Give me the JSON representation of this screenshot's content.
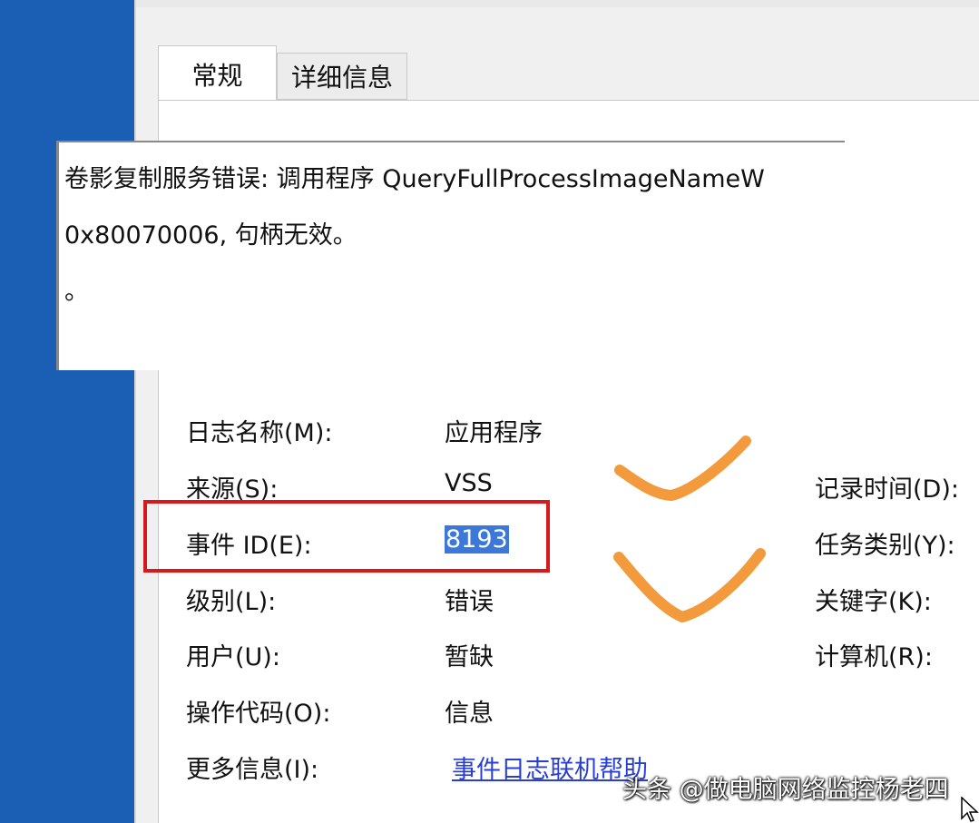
{
  "tabs": [
    {
      "label": "常规",
      "active": true
    },
    {
      "label": "详细信息",
      "active": false
    }
  ],
  "description": {
    "lines": [
      "卷影复制服务错误: 调用程序 QueryFullProcessImageNameW",
      "0x80070006, 句柄无效。",
      "。"
    ]
  },
  "fields_left": [
    {
      "label": "日志名称(M):",
      "value": "应用程序"
    },
    {
      "label": "来源(S):",
      "value": "VSS"
    },
    {
      "label": "事件 ID(E):",
      "value": "8193"
    },
    {
      "label": "级别(L):",
      "value": "错误"
    },
    {
      "label": "用户(U):",
      "value": "暂缺"
    },
    {
      "label": "操作代码(O):",
      "value": "信息"
    },
    {
      "label": "更多信息(I):",
      "value": "事件日志联机帮助"
    }
  ],
  "fields_right": [
    {
      "label": "记录时间(D):"
    },
    {
      "label": "任务类别(Y):"
    },
    {
      "label": "关键字(K):"
    },
    {
      "label": "计算机(R):"
    }
  ],
  "watermark": "头条 @做电脑网络监控杨老四",
  "colors": {
    "desktop": "#1a5fb4",
    "highlight_box": "#d7191c",
    "annotation_marks": "#f39a3c",
    "link": "#2a3fd1",
    "selection": "#3b78d8"
  },
  "icons": {
    "annotation": "checkmark-icon",
    "cursor": "mouse-pointer-icon"
  }
}
